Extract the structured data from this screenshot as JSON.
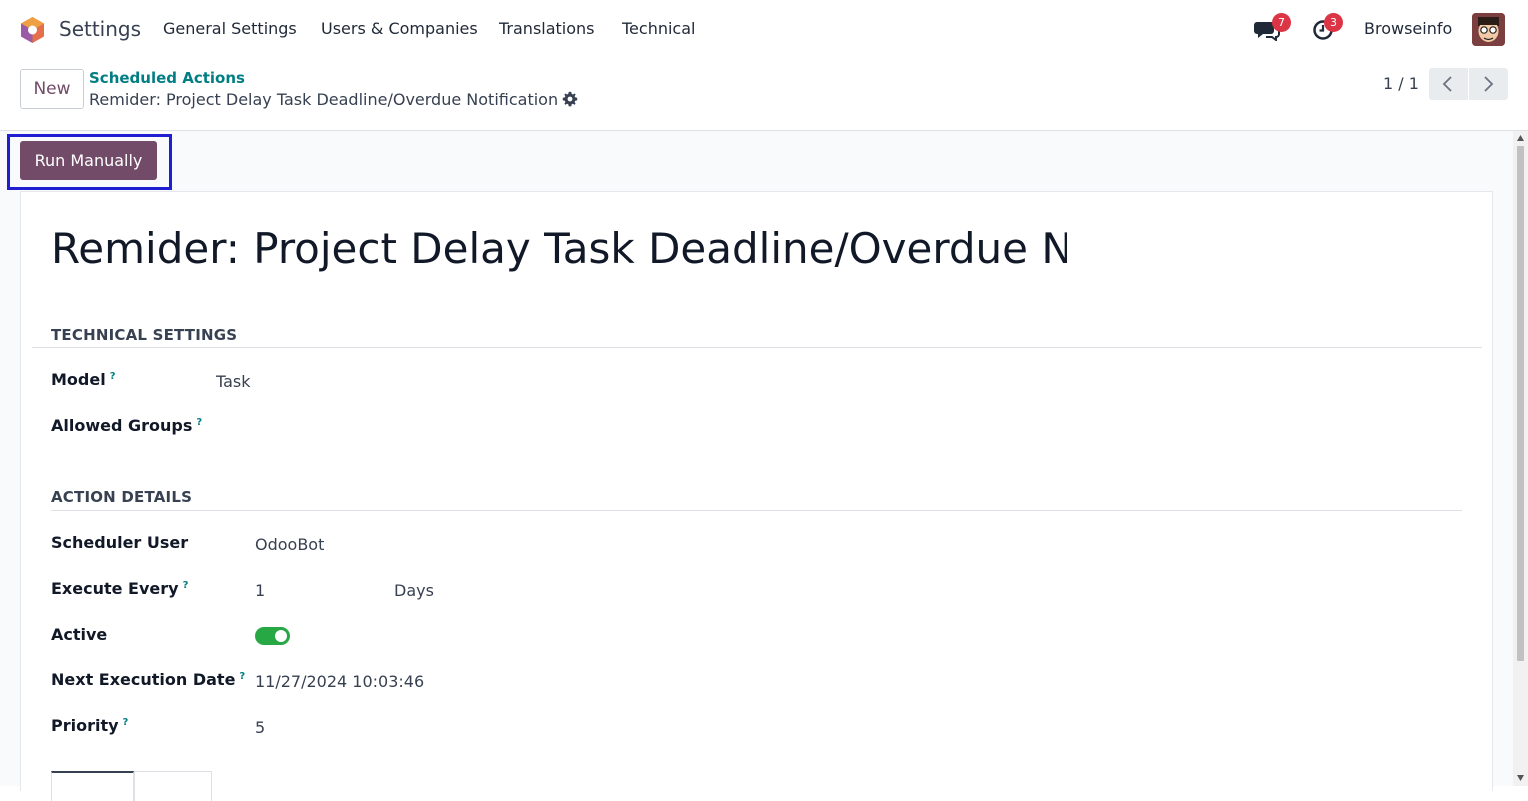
{
  "navbar": {
    "app_name": "Settings",
    "menu": [
      "General Settings",
      "Users & Companies",
      "Translations",
      "Technical"
    ],
    "messages_badge": "7",
    "activities_badge": "3",
    "user_name": "Browseinfo"
  },
  "control_panel": {
    "new_label": "New",
    "breadcrumb_parent": "Scheduled Actions",
    "breadcrumb_current": "Remider: Project Delay Task Deadline/Overdue Notification",
    "pager": "1 / 1"
  },
  "actions": {
    "run_manually": "Run Manually"
  },
  "record": {
    "title": "Remider: Project Delay Task Deadline/Overdue Notification"
  },
  "technical_settings": {
    "title": "TECHNICAL SETTINGS",
    "model_label": "Model",
    "model_value": "Task",
    "allowed_groups_label": "Allowed Groups",
    "help_mark": "?"
  },
  "action_details": {
    "title": "ACTION DETAILS",
    "scheduler_user_label": "Scheduler User",
    "scheduler_user_value": "OdooBot",
    "execute_every_label": "Execute Every",
    "execute_every_number": "1",
    "execute_every_unit": "Days",
    "active_label": "Active",
    "active_value": true,
    "next_execution_label": "Next Execution Date",
    "next_execution_value": "11/27/2024 10:03:46",
    "priority_label": "Priority",
    "priority_value": "5"
  },
  "colors": {
    "brand": "#714b67",
    "link": "#017e84",
    "toggle_on": "#28a745",
    "badge": "#dc3545",
    "highlight": "#1f1fd1"
  }
}
